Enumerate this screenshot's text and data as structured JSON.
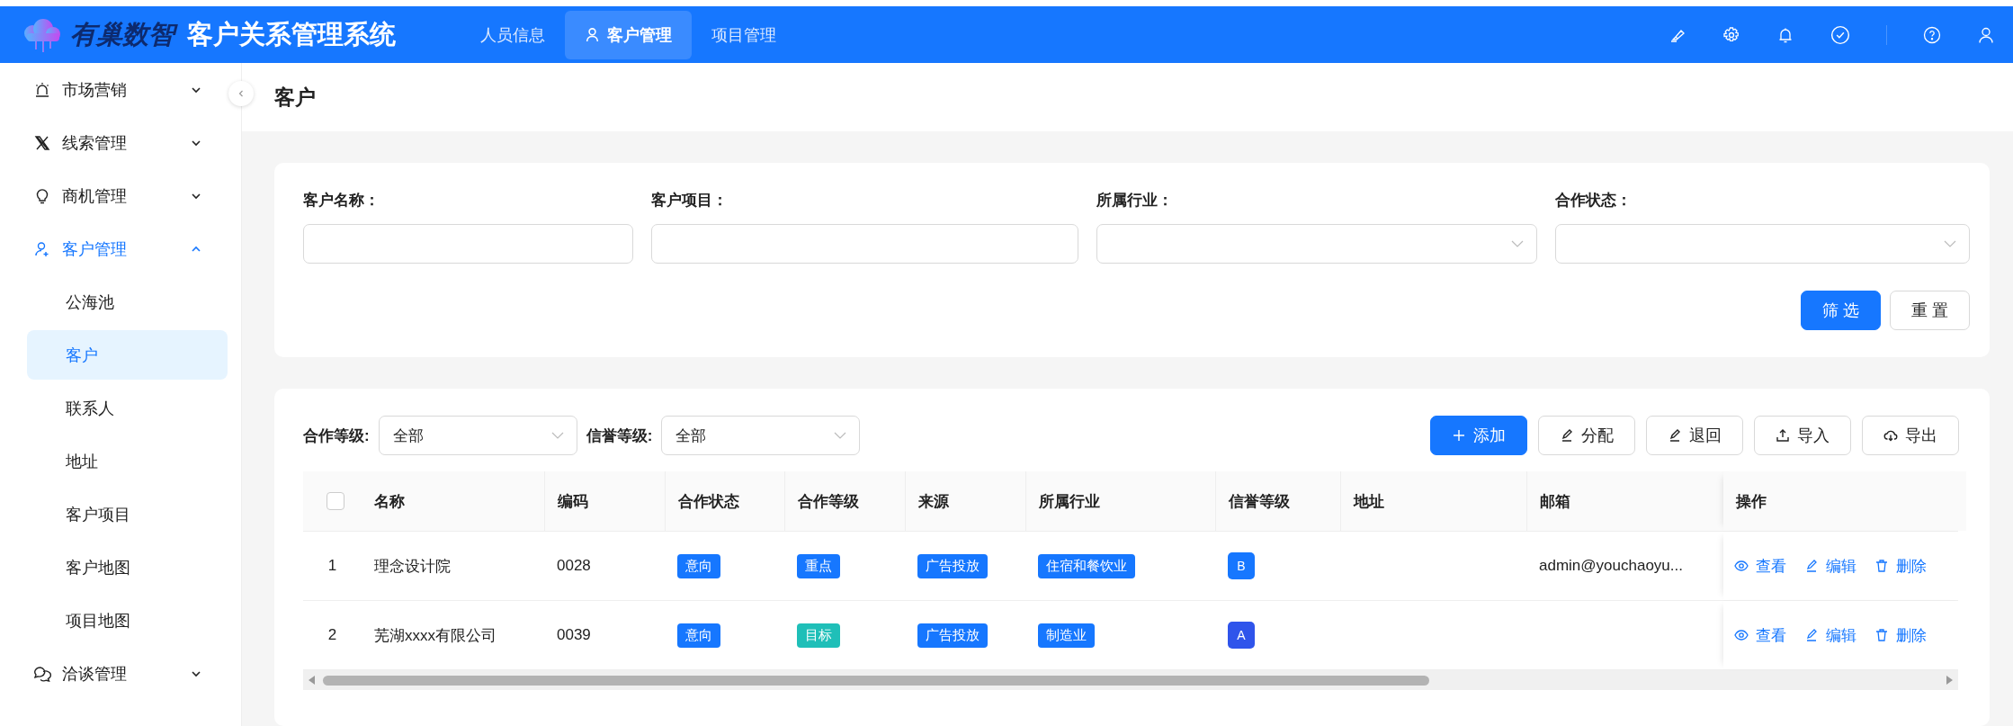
{
  "header": {
    "logo_text": "有巢数智",
    "title": "客户关系管理系统",
    "nav": [
      {
        "label": "人员信息",
        "selected": false
      },
      {
        "label": "客户管理",
        "selected": true
      },
      {
        "label": "项目管理",
        "selected": false
      }
    ]
  },
  "sidebar": {
    "items": [
      {
        "label": "市场营销",
        "expanded": false,
        "selected": false
      },
      {
        "label": "线索管理",
        "expanded": false,
        "selected": false
      },
      {
        "label": "商机管理",
        "expanded": false,
        "selected": false
      },
      {
        "label": "客户管理",
        "expanded": true,
        "selected": true,
        "children": [
          {
            "label": "公海池",
            "selected": false
          },
          {
            "label": "客户",
            "selected": true
          },
          {
            "label": "联系人",
            "selected": false
          },
          {
            "label": "地址",
            "selected": false
          },
          {
            "label": "客户项目",
            "selected": false
          },
          {
            "label": "客户地图",
            "selected": false
          },
          {
            "label": "项目地图",
            "selected": false
          }
        ]
      },
      {
        "label": "洽谈管理",
        "expanded": false,
        "selected": false
      }
    ]
  },
  "page_title": "客户",
  "filters": {
    "fields": [
      {
        "label": "客户名称：",
        "kind": "input"
      },
      {
        "label": "客户项目：",
        "kind": "input"
      },
      {
        "label": "所属行业：",
        "kind": "select"
      },
      {
        "label": "合作状态：",
        "kind": "select"
      }
    ],
    "buttons": [
      {
        "label": "筛选",
        "kind": "primary"
      },
      {
        "label": "重置",
        "kind": "default"
      }
    ]
  },
  "toolbar": {
    "selects": [
      {
        "label": "合作等级:",
        "value": "全部"
      },
      {
        "label": "信誉等级:",
        "value": "全部"
      }
    ],
    "buttons": [
      {
        "label": "添加",
        "kind": "primary"
      },
      {
        "label": "分配",
        "kind": "default"
      },
      {
        "label": "退回",
        "kind": "default"
      },
      {
        "label": "导入",
        "kind": "default"
      },
      {
        "label": "导出",
        "kind": "default"
      }
    ]
  },
  "table": {
    "select_all": {
      "checked": false
    },
    "columns": [
      "名称",
      "编码",
      "合作状态",
      "合作等级",
      "来源",
      "所属行业",
      "信誉等级",
      "地址",
      "邮箱",
      "操作"
    ],
    "rows": [
      {
        "index": "1",
        "name": "理念设计院",
        "code": "0028",
        "tags": [
          {
            "text": "意向",
            "color": "#1677ff"
          },
          {
            "text": "重点",
            "color": "#1677ff"
          },
          {
            "text": "广告投放",
            "color": "#1677ff"
          },
          {
            "text": "住宿和餐饮业",
            "color": "#1677ff"
          }
        ],
        "credit": {
          "text": "B",
          "color": "#1677ff"
        },
        "email": "admin@youchaoyu...",
        "actions": [
          "查看",
          "编辑",
          "删除"
        ]
      },
      {
        "index": "2",
        "name": "芜湖xxxx有限公司",
        "code": "0039",
        "tags": [
          {
            "text": "意向",
            "color": "#1677ff"
          },
          {
            "text": "目标",
            "color": "#1fbfb8"
          },
          {
            "text": "广告投放",
            "color": "#1677ff"
          },
          {
            "text": "制造业",
            "color": "#1677ff"
          }
        ],
        "credit": {
          "text": "A",
          "color": "#2f54eb"
        },
        "actions": [
          "查看",
          "编辑",
          "删除"
        ]
      }
    ]
  }
}
